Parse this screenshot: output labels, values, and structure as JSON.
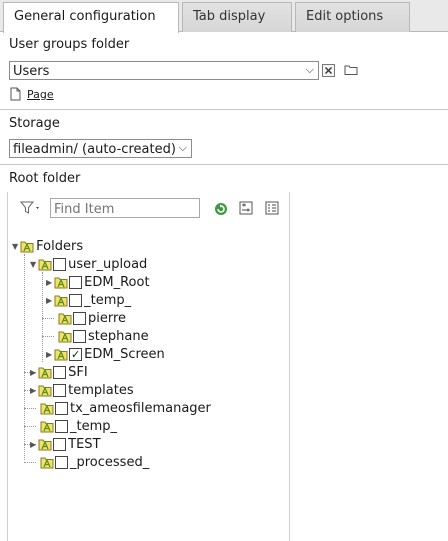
{
  "tabs": [
    {
      "label": "General configuration"
    },
    {
      "label": "Tab display"
    },
    {
      "label": "Edit options"
    }
  ],
  "user_groups": {
    "heading": "User groups folder",
    "selected": "Users",
    "link_label": "Page"
  },
  "storage": {
    "heading": "Storage",
    "selected": "fileadmin/ (auto-created)"
  },
  "root_folder": {
    "heading": "Root folder",
    "search_placeholder": "Find Item"
  },
  "tree": {
    "root": "Folders",
    "items": [
      {
        "label": "user_upload",
        "checked": false
      },
      {
        "label": "EDM_Root",
        "checked": false
      },
      {
        "label": "_temp_",
        "checked": false
      },
      {
        "label": "pierre",
        "checked": false
      },
      {
        "label": "stephane",
        "checked": false
      },
      {
        "label": "EDM_Screen",
        "checked": true
      },
      {
        "label": "SFI",
        "checked": false
      },
      {
        "label": "templates",
        "checked": false
      },
      {
        "label": "tx_ameosfilemanager",
        "checked": false
      },
      {
        "label": "_temp_",
        "checked": false
      },
      {
        "label": "TEST",
        "checked": false
      },
      {
        "label": "_processed_",
        "checked": false
      }
    ]
  },
  "icons": {
    "folder": "folder-icon",
    "clear": "clear-icon",
    "browse": "open-folder-icon",
    "page": "page-icon",
    "filter": "filter-icon",
    "refresh": "refresh-icon",
    "expand": "expand-all-icon",
    "collapse": "collapse-all-icon"
  },
  "colors": {
    "folder_fill": "#f0e36b",
    "folder_mark": "#5a8f1e",
    "refresh": "#3c9a3c"
  }
}
